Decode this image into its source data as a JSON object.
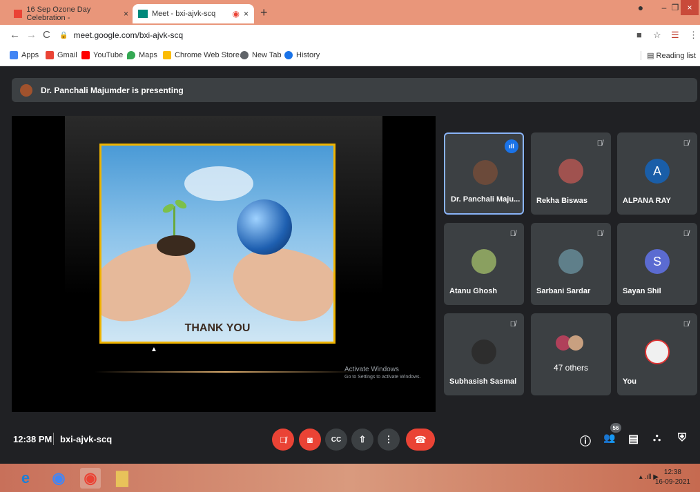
{
  "browser": {
    "tabs": [
      {
        "title": "16 Sep Ozone Day Celebration -",
        "icon": "gmail-icon",
        "close": "×"
      },
      {
        "title": "Meet - bxi-ajvk-scq",
        "icon": "meet-icon",
        "close": "×",
        "recording": "◉"
      }
    ],
    "new_tab": "+",
    "window_controls": {
      "minimize": "–",
      "restore": "❐",
      "close": "×"
    },
    "nav": {
      "back": "←",
      "forward": "→",
      "reload": "C"
    },
    "url": "meet.google.com/bxi-ajvk-scq",
    "lock": "🔒",
    "addr_right": {
      "camera": "■",
      "star": "☆",
      "profile": "☰",
      "menu": "⋮"
    },
    "bookmarks": [
      {
        "label": "Apps",
        "color": "#4285f4"
      },
      {
        "label": "Gmail",
        "color": "#ea4335"
      },
      {
        "label": "YouTube",
        "color": "#ff0000"
      },
      {
        "label": "Maps",
        "color": "#34a853"
      },
      {
        "label": "Chrome Web Store...",
        "color": "#fbbc04"
      },
      {
        "label": "New Tab",
        "color": "#5f6368"
      },
      {
        "label": "History",
        "color": "#1a73e8"
      }
    ],
    "reading_list": "Reading list"
  },
  "meet": {
    "presenting": "Dr. Panchali Majumder is presenting",
    "slide_text": "THANK YOU",
    "watermark": {
      "line1": "Activate Windows",
      "line2": "Go to Settings to activate Windows."
    },
    "tiles": [
      {
        "name": "Dr. Panchali Maju...",
        "avatar_color": "#6b4a3a",
        "speaking": true,
        "mic": ""
      },
      {
        "name": "Rekha Biswas",
        "avatar_color": "#a0524f",
        "speaking": false,
        "mic": "🎙̸"
      },
      {
        "name": "ALPANA RAY",
        "avatar_letter": "A",
        "avatar_color": "#1a5ea8",
        "speaking": false,
        "mic": "🎙̸"
      },
      {
        "name": "Atanu Ghosh",
        "avatar_color": "#8aa060",
        "speaking": false,
        "mic": "🎙̸"
      },
      {
        "name": "Sarbani Sardar",
        "avatar_color": "#5f7f8a",
        "speaking": false,
        "mic": "🎙̸"
      },
      {
        "name": "Sayan Shil",
        "avatar_letter": "S",
        "avatar_color": "#5b6bd1",
        "speaking": false,
        "mic": "🎙̸"
      },
      {
        "name": "Subhasish Sasmal",
        "avatar_color": "#2d2d2d",
        "speaking": false,
        "mic": "🎙̸"
      },
      {
        "name": "47 others",
        "avatar_color": "#b0405a",
        "speaking": false,
        "mic": ""
      },
      {
        "name": "You",
        "avatar_color": "#f0f0f0",
        "speaking": false,
        "mic": "🎙̸"
      }
    ],
    "speaking_indicator": "ıll",
    "time": "12:38 PM",
    "meeting_code": "bxi-ajvk-scq",
    "controls": {
      "mic": "🎙̸",
      "camera": "◙",
      "captions": "CC",
      "present": "⇧",
      "more": "⋮",
      "end": "☎"
    },
    "right_controls": {
      "info": "ⓘ",
      "people": "👥",
      "chat": "▤",
      "activities": "⛬",
      "host": "⛨"
    },
    "people_count": "56"
  },
  "taskbar": {
    "apps": [
      {
        "name": "ie-icon",
        "glyph": "e",
        "color": "#1e7fd6"
      },
      {
        "name": "chrome-icon-1",
        "glyph": "◉",
        "color": "#4285f4"
      },
      {
        "name": "chrome-icon-2",
        "glyph": "◉",
        "color": "#ea4335"
      },
      {
        "name": "file-explorer-icon",
        "glyph": "▇",
        "color": "#e8c25a"
      }
    ],
    "tray": "▴ .ıll ▶",
    "time": "12:38",
    "date": "16-09-2021"
  },
  "colors": {
    "accent": "#1a73e8",
    "danger": "#ea4335",
    "tile_bg": "#3c4043",
    "meet_bg": "#202124"
  }
}
